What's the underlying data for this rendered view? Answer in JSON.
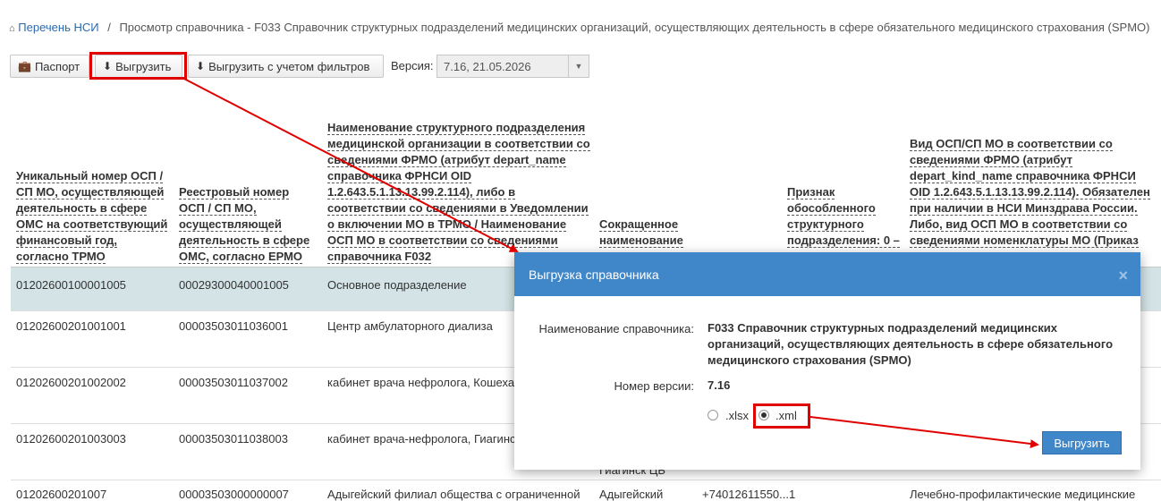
{
  "breadcrumb": {
    "home_icon": "home-icon",
    "home_link": "Перечень НСИ",
    "separator": "/",
    "current": "Просмотр справочника - F033 Справочник структурных подразделений медицинских организаций, осуществляющих деятельность в сфере обязательного медицинского страхования (SPMO)"
  },
  "toolbar": {
    "passport": {
      "label": "Паспорт",
      "icon": "briefcase-icon"
    },
    "export": {
      "label": "Выгрузить",
      "icon": "download-icon"
    },
    "export_filtered": {
      "label": "Выгрузить с учетом фильтров",
      "icon": "download-icon"
    },
    "version_label": "Версия:",
    "version_value": "7.16, 21.05.2026"
  },
  "table": {
    "headers": [
      [
        "Уникальный номер ОСП /",
        "СП МО, осуществляющей",
        "деятельность в сфере",
        "ОМС на соответствующий",
        "финансовый год,",
        "согласно ТРМО"
      ],
      [
        "Реестровый номер",
        "ОСП / СП МО,",
        "осуществляющей",
        "деятельность в сфере",
        "ОМС, согласно ЕРМО"
      ],
      [
        "Наименование структурного подразделения",
        "медицинской организации в соответствии со",
        "сведениями ФРМО (атрибут depart_name",
        "справочника ФРНСИ OID",
        "1.2.643.5.1.13.13.99.2.114), либо в",
        "соответствии со сведениями в Уведомлении",
        "о включении МО в ТРМО / Наименование",
        "ОСП МО в соответствии со сведениями",
        "справочника F032"
      ],
      [
        "Сокращенное",
        "наименование"
      ],
      [
        "Признак",
        "обособленного",
        "структурного",
        "подразделения: 0 –"
      ],
      [
        "Вид ОСП/СП МО в соответствии со",
        "сведениями ФРМО (атрибут",
        "depart_kind_name справочника ФРНСИ",
        "OID 1.2.643.5.1.13.13.99.2.114). Обязателен",
        "при наличии в НСИ Минздрава России.",
        "Либо, вид ОСП МО в соответствии со",
        "сведениями номенклатуры МО (Приказ"
      ]
    ],
    "rows": [
      {
        "c1": "01202600100001005",
        "c2": "00029300040001005",
        "c3": "Основное подразделение",
        "c4": "",
        "c5": "",
        "c6": ""
      },
      {
        "c1": "01202600201001001",
        "c2": "00003503011036001",
        "c3": "Центр амбулаторного диализа",
        "c4": "",
        "c5": "",
        "c6": ""
      },
      {
        "c1": "01202600201002002",
        "c2": "00003503011037002",
        "c3": "кабинет врача нефролога, Кошехабльская ЦРБ",
        "c4": "",
        "c5": "",
        "c6": ""
      },
      {
        "c1": "01202600201003003",
        "c2": "00003503011038003",
        "c3": "кабинет врача-нефролога, Гиагинская ЦБ",
        "c4": "Гиагинск ЦБ",
        "c5": "",
        "c6": ""
      },
      {
        "c1": "01202600201007",
        "c2": "00003503000000007",
        "c3": "Адыгейский филиал общества с ограниченной",
        "c4": "Адыгейский",
        "c5": "+74012611550...1",
        "c6": "Лечебно-профилактические медицинские"
      }
    ]
  },
  "modal": {
    "title": "Выгрузка справочника",
    "close_icon": "close-icon",
    "name_label": "Наименование справочника:",
    "name_lines": [
      "F033 Справочник структурных подразделений медицинских",
      "организаций, осуществляющих деятельность в сфере обязательного",
      "медицинского страхования (SPMO)"
    ],
    "version_label": "Номер версии:",
    "version_value": "7.16",
    "format_options": [
      ".xlsx",
      ".xml"
    ],
    "selected_format": ".xml",
    "submit_label": "Выгрузить"
  },
  "colors": {
    "accent": "#3f87c9",
    "selected_row": "#d3e3e6",
    "annotation_red": "#e00000",
    "link": "#2a6ab0"
  }
}
